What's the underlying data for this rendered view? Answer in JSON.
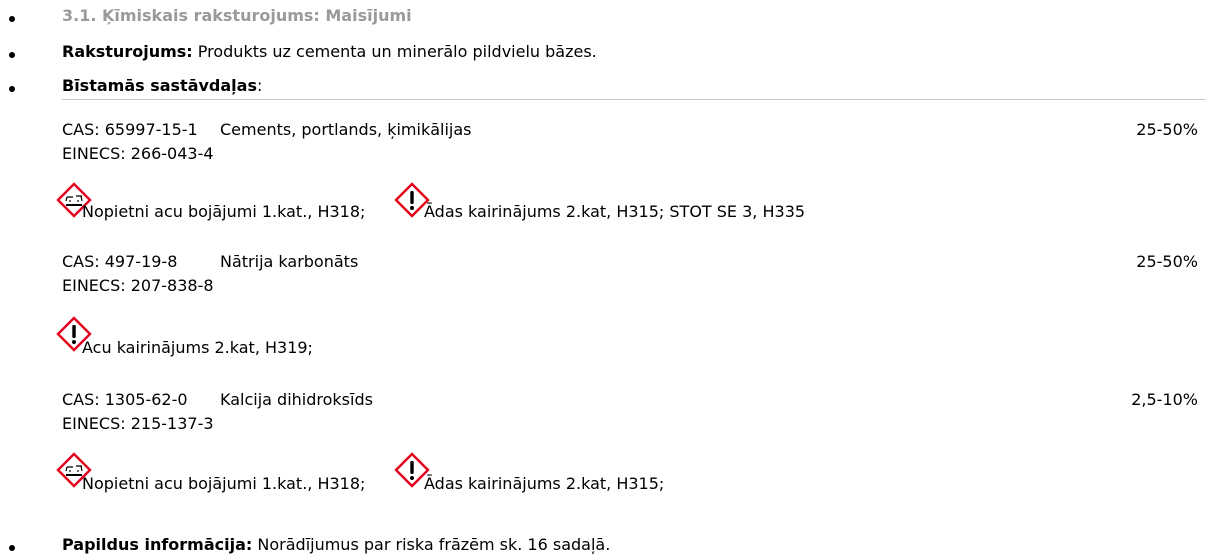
{
  "heading": "3.1. Ķīmiskais raksturojums: Maisījumi",
  "characterisation": {
    "label": "Raksturojums:",
    "text": "Produkts uz cementa un minerālo pildvielu bāzes."
  },
  "hazardous": {
    "label": "Bīstamās sastāvdaļas",
    "colon": ":"
  },
  "components": [
    {
      "cas": "CAS: 65997-15-1",
      "name": "Cements, portlands, ķimikālijas",
      "einecs": "EINECS: 266-043-4",
      "percent": "25-50%",
      "classes": [
        {
          "icon": "corrosion-icon",
          "text": "Nopietni acu bojājumi 1.kat., H318;"
        },
        {
          "icon": "exclamation-icon",
          "text": "Ādas kairinājums 2.kat, H315; STOT SE 3, H335"
        }
      ]
    },
    {
      "cas": "CAS: 497-19-8",
      "name": "Nātrija karbonāts",
      "einecs": "EINECS: 207-838-8",
      "percent": "25-50%",
      "classes": [
        {
          "icon": "exclamation-icon",
          "text": "Acu kairinājums 2.kat, H319;"
        }
      ]
    },
    {
      "cas": "CAS: 1305-62-0",
      "name": "Kalcija dihidroksīds",
      "einecs": "EINECS: 215-137-3",
      "percent": "2,5-10%",
      "classes": [
        {
          "icon": "corrosion-icon",
          "text": "Nopietni acu bojājumi 1.kat., H318;"
        },
        {
          "icon": "exclamation-icon",
          "text": "Ādas kairinājums 2.kat, H315;"
        }
      ]
    }
  ],
  "additional": {
    "label": "Papildus informācija:",
    "text": "Norādījumus par riska frāzēm sk. 16 sadaļā."
  },
  "colors": {
    "ghs_border": "#e3001b",
    "heading_grey": "#9a9a9a"
  }
}
